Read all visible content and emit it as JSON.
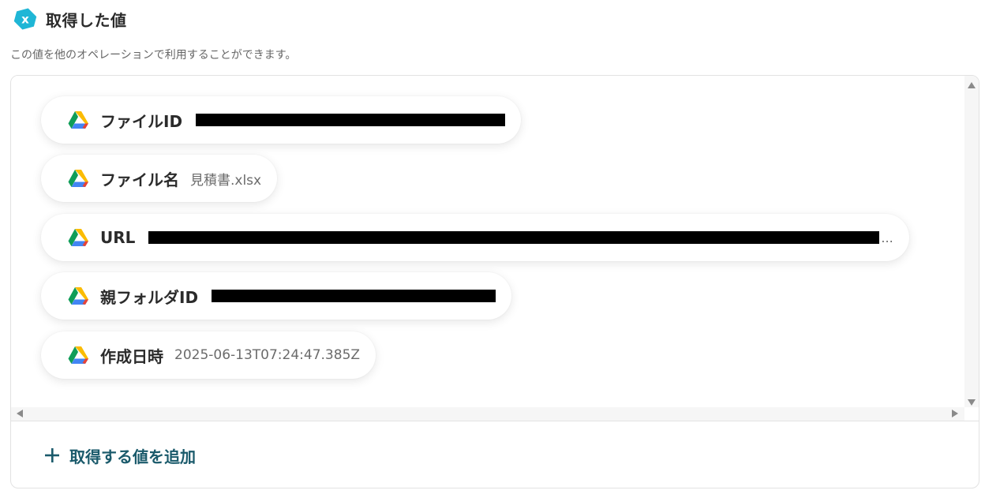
{
  "header": {
    "title": "取得した値",
    "icon": "variable-x-icon",
    "icon_color": "#1fb6d6"
  },
  "subtitle": "この値を他のオペレーションで利用することができます。",
  "items": [
    {
      "label": "ファイルID",
      "value": "",
      "redacted": true,
      "icon": "google-drive-icon"
    },
    {
      "label": "ファイル名",
      "value": "見積書.xlsx",
      "redacted": false,
      "icon": "google-drive-icon"
    },
    {
      "label": "URL",
      "value": "",
      "redacted": true,
      "truncated": "...",
      "icon": "google-drive-icon"
    },
    {
      "label": "親フォルダID",
      "value": "",
      "redacted": true,
      "icon": "google-drive-icon"
    },
    {
      "label": "作成日時",
      "value": "2025-06-13T07:24:47.385Z",
      "redacted": false,
      "icon": "google-drive-icon"
    }
  ],
  "add_button": {
    "label": "取得する値を追加",
    "icon": "plus-icon",
    "color": "#1a5a6b"
  }
}
